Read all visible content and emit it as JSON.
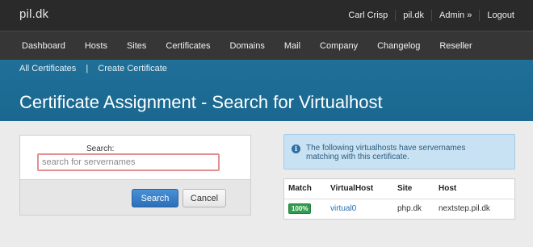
{
  "header": {
    "brand": "pil.dk",
    "user_links": [
      "Carl Crisp",
      "pil.dk",
      "Admin »",
      "Logout"
    ]
  },
  "nav": {
    "items": [
      "Dashboard",
      "Hosts",
      "Sites",
      "Certificates",
      "Domains",
      "Mail",
      "Company",
      "Changelog",
      "Reseller"
    ]
  },
  "subnav": {
    "all_certificates": "All Certificates",
    "separator": "|",
    "create_certificate": "Create Certificate"
  },
  "page": {
    "title": "Certificate Assignment - Search for Virtualhost"
  },
  "search": {
    "label": "Search:",
    "value": "",
    "placeholder": "search for servernames",
    "submit_label": "Search",
    "cancel_label": "Cancel"
  },
  "alert": {
    "icon": "info-icon",
    "text": "The following virtualhosts have servernames matching with this certificate."
  },
  "results": {
    "columns": [
      "Match",
      "VirtualHost",
      "Site",
      "Host"
    ],
    "rows": [
      {
        "match": "100%",
        "virtualhost": "virtual0",
        "site": "php.dk",
        "host": "nextstep.pil.dk"
      }
    ]
  },
  "colors": {
    "topbar": "#2a2a2a",
    "navbar": "#363636",
    "hero": "#1f6f98",
    "primary_button": "#2b6fb8",
    "match_badge": "#2e9d4d",
    "alert_bg": "#c8e1f3",
    "input_border_invalid": "#e28f94"
  }
}
